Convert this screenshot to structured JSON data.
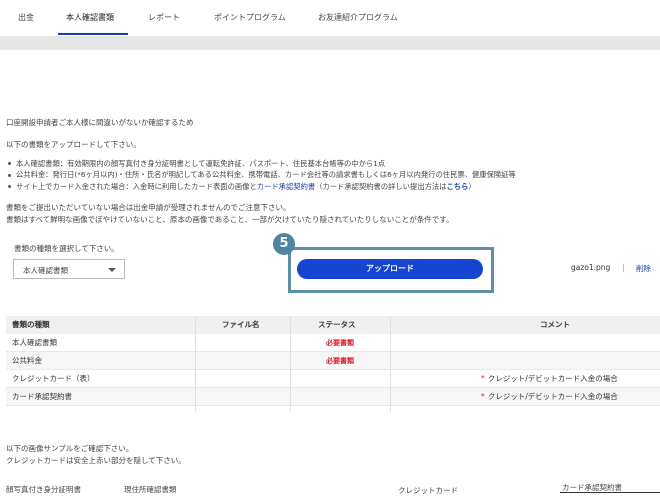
{
  "tabs": [
    {
      "label": "出金"
    },
    {
      "label": "本人確認書類"
    },
    {
      "label": "レポート"
    },
    {
      "label": "ポイントプログラム"
    },
    {
      "label": "お友達紹介プログラム"
    }
  ],
  "intro": {
    "line1": "口座開設申請者ご本人様に間違いがないか確認するため",
    "line2": "以下の書類をアップロードして下さい。"
  },
  "bullets": {
    "b1": "本人確認書類：有効期限内の顔写真付き身分証明書として運転免許証、パスポート、住民基本台帳等の中から1点",
    "b2": "公共料金：発行日(*6ヶ月以内)・住所・氏名が明記してある公共料金、携帯電話、カード会社等の請求書もしくは6ヶ月以内発行の住民票、健康保険証等",
    "b3_pre": "サイト上でカード入金された場合：入金時に利用したカード表面の画像と",
    "b3_link1": "カード承認契約書",
    "b3_mid": "（カード承認契約書の詳しい提出方法は",
    "b3_link2": "こちら",
    "b3_post": "）"
  },
  "notes": {
    "n1": "書類をご提出いただいていない場合は出金申請が受理されませんのでご注意下さい。",
    "n2": "書類はすべて鮮明な画像でぼやけていないこと、原本の画像であること、一部が欠けていたり隠されていたりしないことが条件です。"
  },
  "selector": {
    "prompt": "書類の種類を選択して下さい。",
    "selected": "本人確認書類"
  },
  "upload": {
    "step": "5",
    "button_label": "アップロード",
    "file_name": "gazo1.png",
    "separator": "|",
    "delete_label": "削除"
  },
  "table": {
    "headers": [
      "書類の種類",
      "ファイル名",
      "ステータス",
      "コメント"
    ],
    "rows": [
      {
        "type": "本人確認書類",
        "file": "",
        "status": "必要書類",
        "comment": ""
      },
      {
        "type": "公共料金",
        "file": "",
        "status": "必要書類",
        "comment": ""
      },
      {
        "type": "クレジットカード（表）",
        "file": "",
        "status": "",
        "comment_star": "*",
        "comment": "クレジット/デビットカード入金の場合"
      },
      {
        "type": "カード承認契約書",
        "file": "",
        "status": "",
        "comment_star": "*",
        "comment": "クレジット/デビットカード入金の場合"
      }
    ]
  },
  "samples": {
    "line1": "以下の画像サンプルをご確認下さい。",
    "line2": "クレジットカードは安全上赤い部分を隠して下さい。",
    "labels": [
      "顔写真付き身分証明書",
      "現住所確認書類",
      "クレジットカード",
      "カード承認契約書"
    ]
  },
  "colors": {
    "accent": "#1545d1",
    "link": "#1a3ea8",
    "required": "#e0202d",
    "highlight_frame": "#5d8fa8"
  }
}
